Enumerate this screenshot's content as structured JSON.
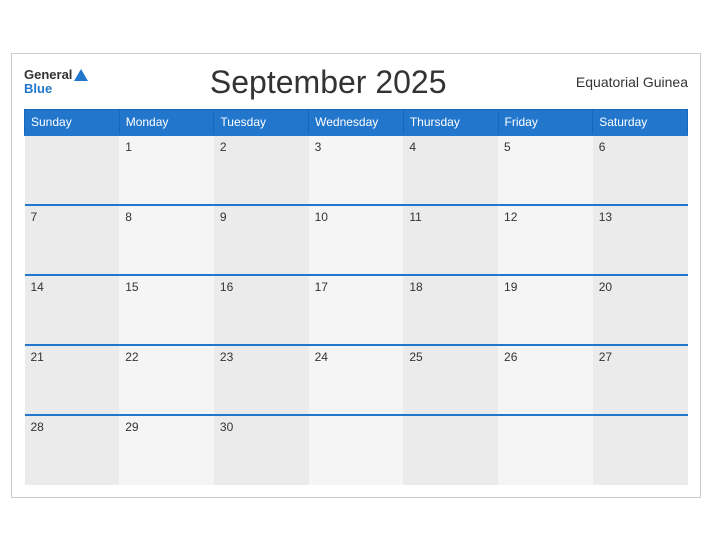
{
  "header": {
    "logo_general": "General",
    "logo_blue": "Blue",
    "title": "September 2025",
    "country": "Equatorial Guinea"
  },
  "weekdays": [
    "Sunday",
    "Monday",
    "Tuesday",
    "Wednesday",
    "Thursday",
    "Friday",
    "Saturday"
  ],
  "weeks": [
    [
      "",
      "1",
      "2",
      "3",
      "4",
      "5",
      "6"
    ],
    [
      "7",
      "8",
      "9",
      "10",
      "11",
      "12",
      "13"
    ],
    [
      "14",
      "15",
      "16",
      "17",
      "18",
      "19",
      "20"
    ],
    [
      "21",
      "22",
      "23",
      "24",
      "25",
      "26",
      "27"
    ],
    [
      "28",
      "29",
      "30",
      "",
      "",
      "",
      ""
    ]
  ]
}
